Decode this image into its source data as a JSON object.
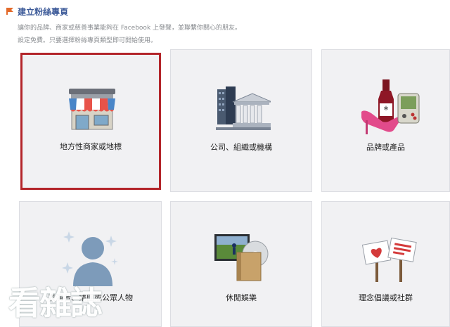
{
  "header": {
    "title": "建立粉絲專頁",
    "desc_line1": "讓你的品牌、商家或慈善事業能夠在 Facebook 上發聲，並聯繫你關心的朋友。",
    "desc_line2": "設定免費。只要選擇粉絲專頁類型即可開始使用。"
  },
  "categories": [
    {
      "label": "地方性商家或地標",
      "icon": "storefront-icon",
      "selected": true
    },
    {
      "label": "公司、組織或機構",
      "icon": "buildings-icon",
      "selected": false
    },
    {
      "label": "品牌或產品",
      "icon": "brand-products-icon",
      "selected": false
    },
    {
      "label": "表演者、樂團或公眾人物",
      "icon": "public-figure-icon",
      "selected": false
    },
    {
      "label": "休閒娛樂",
      "icon": "entertainment-icon",
      "selected": false
    },
    {
      "label": "理念倡議或社群",
      "icon": "cause-community-icon",
      "selected": false
    }
  ],
  "watermark": {
    "text": "看雜誌"
  },
  "colors": {
    "accent": "#3b5998",
    "selected_border": "#b3252a",
    "tile_bg": "#f1f1f3"
  }
}
